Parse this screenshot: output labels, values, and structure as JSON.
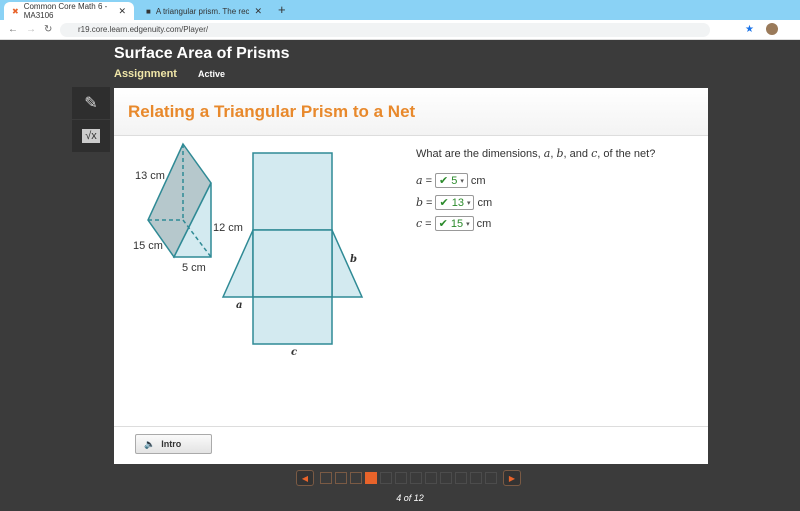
{
  "browser": {
    "tabs": [
      {
        "title": "Common Core Math 6 - MA3106",
        "active": true
      },
      {
        "title": "A triangular prism. The rectangle",
        "active": false
      }
    ],
    "url": "r19.core.learn.edgenuity.com/Player/"
  },
  "header": {
    "title": "Surface Area of Prisms",
    "subtitle": "Assignment",
    "status": "Active"
  },
  "tools": [
    {
      "icon": "pencil-icon"
    },
    {
      "icon": "calculator-icon"
    }
  ],
  "lesson": {
    "title": "Relating a Triangular Prism to a Net",
    "figure": {
      "prism_labels": [
        "13 cm",
        "15 cm",
        "5 cm",
        "12 cm"
      ],
      "net_labels": [
        "a",
        "b",
        "c"
      ],
      "fill": "#d3eaf0",
      "shade": "#b6c8cc",
      "stroke": "#2f8a95"
    },
    "question": "What are the dimensions, a, b, and c, of the net?",
    "answers": [
      {
        "var": "a",
        "value": "5",
        "unit": "cm",
        "correct": true
      },
      {
        "var": "b",
        "value": "13",
        "unit": "cm",
        "correct": true
      },
      {
        "var": "c",
        "value": "15",
        "unit": "cm",
        "correct": true
      }
    ],
    "intro_label": "Intro"
  },
  "pager": {
    "current": 4,
    "total": 12,
    "label": "4 of 12"
  },
  "colors": {
    "accent": "#e8892c",
    "correct": "#2a8a2a",
    "current_page": "#e8632a"
  }
}
